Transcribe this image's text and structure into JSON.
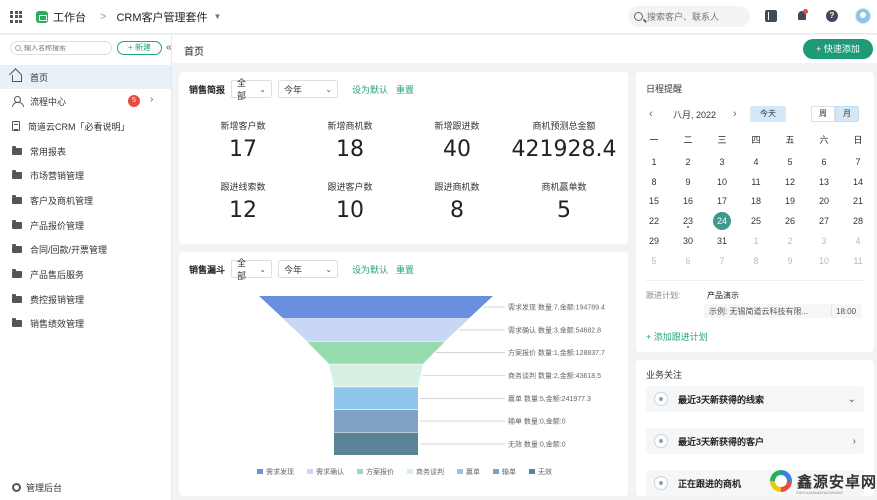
{
  "topbar": {
    "workspace": "工作台",
    "separator": ">",
    "app_name": "CRM客户管理套件",
    "search_placeholder": "搜索客户、联系人",
    "help_glyph": "?"
  },
  "sidebar": {
    "search_placeholder": "输入名称搜索",
    "new_button": "+ 新建",
    "collapse_glyph": "«",
    "items": [
      {
        "label": "首页",
        "icon": "home-icon"
      },
      {
        "label": "流程中心",
        "icon": "flow-icon",
        "badge": "5"
      },
      {
        "label": "简道云CRM「必看说明」",
        "icon": "doc-icon"
      },
      {
        "label": "常用报表",
        "icon": "folder-icon"
      },
      {
        "label": "市场营销管理",
        "icon": "folder-icon"
      },
      {
        "label": "客户及商机管理",
        "icon": "folder-icon"
      },
      {
        "label": "产品报价管理",
        "icon": "folder-icon"
      },
      {
        "label": "合同/回款/开票管理",
        "icon": "folder-icon"
      },
      {
        "label": "产品售后服务",
        "icon": "folder-icon"
      },
      {
        "label": "费控报销管理",
        "icon": "folder-icon"
      },
      {
        "label": "销售绩效管理",
        "icon": "folder-icon"
      }
    ],
    "footer": "管理后台"
  },
  "header": {
    "title": "首页",
    "quick_add": "+ 快速添加"
  },
  "sales_brief": {
    "title": "销售简报",
    "filter_scope": "全部",
    "filter_period": "今年",
    "set_default": "设为默认",
    "reset": "重置",
    "stats": [
      {
        "label": "新增客户数",
        "value": "17"
      },
      {
        "label": "新增商机数",
        "value": "18"
      },
      {
        "label": "新增跟进数",
        "value": "40"
      },
      {
        "label": "商机预测总金额",
        "value": "421928.4"
      },
      {
        "label": "跟进线索数",
        "value": "12"
      },
      {
        "label": "跟进客户数",
        "value": "10"
      },
      {
        "label": "跟进商机数",
        "value": "8"
      },
      {
        "label": "商机赢单数",
        "value": "5"
      }
    ]
  },
  "funnel": {
    "title": "销售漏斗",
    "filter_scope": "全部",
    "filter_period": "今年",
    "set_default": "设为默认",
    "reset": "重置"
  },
  "chart_data": {
    "type": "funnel",
    "title": "",
    "stages": [
      {
        "name": "需求发现",
        "count": 7,
        "amount": 194789.4,
        "label": "需求发现 数量:7,金额:194789.4",
        "color": "#6b8fe0"
      },
      {
        "name": "需求确认",
        "count": 3,
        "amount": 54682.8,
        "label": "需求确认 数量:3,金额:54682.8",
        "color": "#c9d7f5"
      },
      {
        "name": "方案报价",
        "count": 1,
        "amount": 128837.7,
        "label": "方案报价 数量:1,金额:128837.7",
        "color": "#97dcae"
      },
      {
        "name": "商务谈判",
        "count": 2,
        "amount": 43618.5,
        "label": "商务谈判 数量:2,金额:43618.5",
        "color": "#d6f1e3"
      },
      {
        "name": "赢单",
        "count": 5,
        "amount": 241977.3,
        "label": "赢单 数量:5,金额:241977.3",
        "color": "#8ec6ec"
      },
      {
        "name": "输单",
        "count": 0,
        "amount": 0,
        "label": "输单 数量:0,金额:0",
        "color": "#7fa2c4"
      },
      {
        "name": "无效",
        "count": 0,
        "amount": 0,
        "label": "无效 数量:0,金额:0",
        "color": "#5a8398"
      }
    ],
    "legend": [
      "需求发现",
      "需求确认",
      "方案报价",
      "商务谈判",
      "赢单",
      "输单",
      "无效"
    ],
    "legend_position": "bottom"
  },
  "calendar": {
    "title": "日程提醒",
    "month_label": "八月, 2022",
    "prev_glyph": "‹",
    "next_glyph": "›",
    "today_button": "今天",
    "week_button": "周",
    "month_button": "月",
    "weekdays": [
      "一",
      "二",
      "三",
      "四",
      "五",
      "六",
      "日"
    ],
    "weeks": [
      [
        {
          "d": "1"
        },
        {
          "d": "2"
        },
        {
          "d": "3"
        },
        {
          "d": "4"
        },
        {
          "d": "5"
        },
        {
          "d": "6"
        },
        {
          "d": "7"
        }
      ],
      [
        {
          "d": "8"
        },
        {
          "d": "9"
        },
        {
          "d": "10"
        },
        {
          "d": "11"
        },
        {
          "d": "12"
        },
        {
          "d": "13"
        },
        {
          "d": "14"
        }
      ],
      [
        {
          "d": "15"
        },
        {
          "d": "16"
        },
        {
          "d": "17"
        },
        {
          "d": "18"
        },
        {
          "d": "19"
        },
        {
          "d": "20"
        },
        {
          "d": "21"
        }
      ],
      [
        {
          "d": "22"
        },
        {
          "d": "23",
          "event": true
        },
        {
          "d": "24",
          "today": true
        },
        {
          "d": "25"
        },
        {
          "d": "26"
        },
        {
          "d": "27"
        },
        {
          "d": "28"
        }
      ],
      [
        {
          "d": "29"
        },
        {
          "d": "30"
        },
        {
          "d": "31"
        },
        {
          "d": "1",
          "muted": true
        },
        {
          "d": "2",
          "muted": true
        },
        {
          "d": "3",
          "muted": true
        },
        {
          "d": "4",
          "muted": true
        }
      ],
      [
        {
          "d": "5",
          "muted": true
        },
        {
          "d": "6",
          "muted": true
        },
        {
          "d": "7",
          "muted": true
        },
        {
          "d": "8",
          "muted": true
        },
        {
          "d": "9",
          "muted": true
        },
        {
          "d": "10",
          "muted": true
        },
        {
          "d": "11",
          "muted": true
        }
      ]
    ],
    "followup_label": "跟进计划:",
    "followup_title": "产品演示",
    "followup_example": "示例: 无锡简道云科技有限...",
    "followup_time": "18:00",
    "add_followup": "+ 添加跟进计划"
  },
  "business": {
    "title": "业务关注",
    "items": [
      {
        "label": "最近3天新获得的线索",
        "chevron": "⌄"
      },
      {
        "label": "最近3天新获得的客户",
        "chevron": "›"
      },
      {
        "label": "正在跟进的商机",
        "chevron": ""
      }
    ]
  },
  "watermark": {
    "text": "鑫源安卓网",
    "sub": "XINYUANANZHUOWANG"
  },
  "colors": {
    "accent": "#26a27f",
    "primary_button": "#1e9a78",
    "today": "#3f9a8e",
    "badge": "#e74c3c"
  }
}
